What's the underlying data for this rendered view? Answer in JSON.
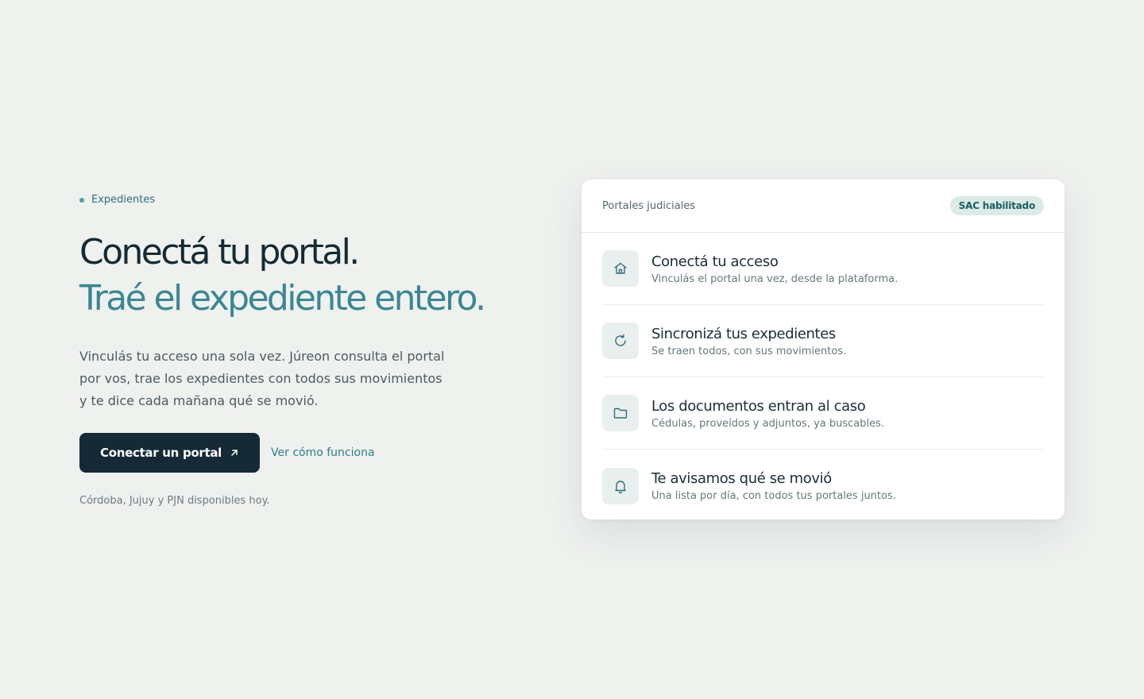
{
  "hero": {
    "eyebrow": "Expedientes",
    "headline_line1": "Conectá tu portal.",
    "headline_line2": "Traé el expediente entero.",
    "lede": "Vinculás tu acceso una sola vez. Júreon consulta el portal por vos, trae los expedientes con todos sus movimientos y te dice cada mañana qué se movió.",
    "primary_button": "Conectar un portal",
    "secondary_link": "Ver cómo funciona",
    "availability": "Córdoba, Jujuy y PJN disponibles hoy."
  },
  "card": {
    "title": "Portales judiciales",
    "badge": "SAC habilitado",
    "steps": [
      {
        "icon": "courthouse-icon",
        "title": "Conectá tu acceso",
        "description": "Vinculás el portal una vez, desde la plataforma."
      },
      {
        "icon": "refresh-icon",
        "title": "Sincronizá tus expedientes",
        "description": "Se traen todos, con sus movimientos."
      },
      {
        "icon": "folder-icon",
        "title": "Los documentos entran al caso",
        "description": "Cédulas, proveídos y adjuntos, ya buscables."
      },
      {
        "icon": "bell-icon",
        "title": "Te avisamos qué se movió",
        "description": "Una lista por día, con todos tus portales juntos."
      }
    ]
  },
  "colors": {
    "background": "#eff1ef",
    "primary_dark": "#152a36",
    "accent_teal": "#3a8792",
    "badge_bg": "#dcebe8"
  }
}
